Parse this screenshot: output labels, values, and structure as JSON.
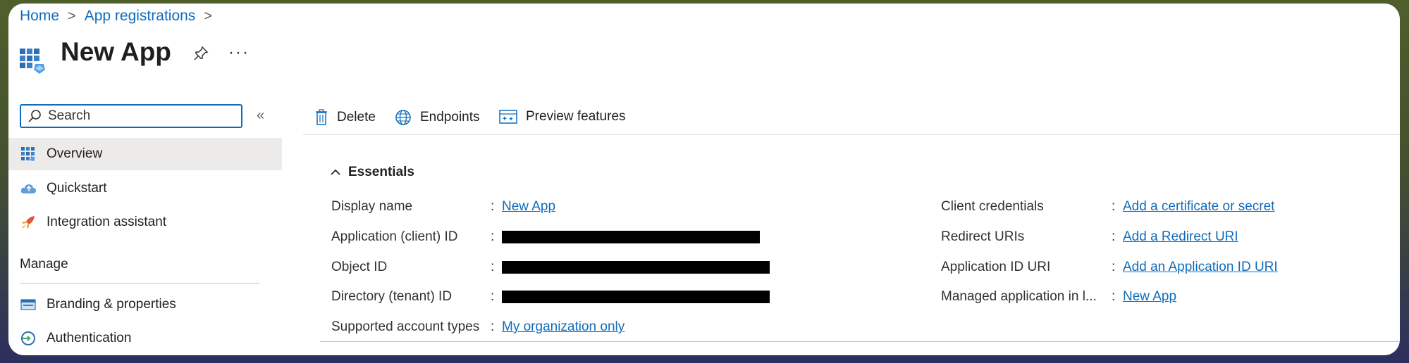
{
  "breadcrumb": {
    "home": "Home",
    "separator": ">",
    "app_registrations": "App registrations",
    "trailing_separator": ">"
  },
  "header": {
    "title": "New App",
    "pin_icon": "pin-icon",
    "more_label": "···"
  },
  "sidebar": {
    "search_placeholder": "Search",
    "collapse_label": "«",
    "items": [
      {
        "label": "Overview",
        "icon": "overview-grid-icon",
        "active": true
      },
      {
        "label": "Quickstart",
        "icon": "cloud-icon"
      },
      {
        "label": "Integration assistant",
        "icon": "rocket-icon"
      }
    ],
    "section_manage": "Manage",
    "manage_items": [
      {
        "label": "Branding & properties",
        "icon": "branding-icon"
      },
      {
        "label": "Authentication",
        "icon": "authentication-icon"
      }
    ]
  },
  "toolbar": {
    "delete_label": "Delete",
    "endpoints_label": "Endpoints",
    "preview_label": "Preview features"
  },
  "essentials": {
    "heading": "Essentials",
    "left": [
      {
        "label": "Display name",
        "value": "New App"
      },
      {
        "label": "Application (client) ID",
        "value": ""
      },
      {
        "label": "Object ID",
        "value": ""
      },
      {
        "label": "Directory (tenant) ID",
        "value": ""
      },
      {
        "label": "Supported account types",
        "value": "My organization only"
      }
    ],
    "right": [
      {
        "label": "Client credentials",
        "value": "Add a certificate or secret"
      },
      {
        "label": "Redirect URIs",
        "value": "Add a Redirect URI"
      },
      {
        "label": "Application ID URI",
        "value": "Add an Application ID URI"
      },
      {
        "label": "Managed application in l...",
        "value": "New App"
      }
    ],
    "colon": ":"
  },
  "colors": {
    "accent": "#0f6cbd",
    "active_bg": "#edebe9",
    "text": "#201f1e"
  }
}
